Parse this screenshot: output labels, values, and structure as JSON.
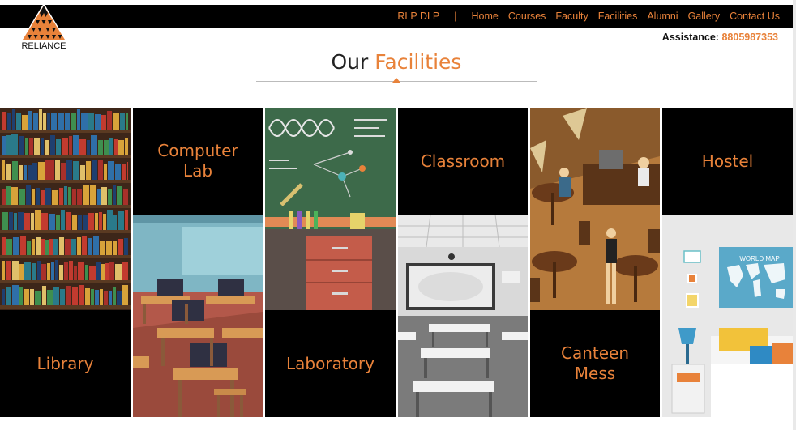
{
  "brand": {
    "name": "RELIANCE"
  },
  "nav": {
    "items": [
      "RLP DLP",
      "Home",
      "Courses",
      "Faculty",
      "Facilities",
      "Alumni",
      "Gallery",
      "Contact Us"
    ],
    "separator": "|"
  },
  "assistance": {
    "label": "Assistance:",
    "phone": "8805987353"
  },
  "heading": {
    "prefix": "Our",
    "accent": "Facilities"
  },
  "facilities": {
    "library": "Library",
    "computer_lab": "Computer\nLab",
    "laboratory": "Laboratory",
    "classroom": "Classroom",
    "canteen": "Canteen\nMess",
    "hostel": "Hostel"
  },
  "illustrations": {
    "world_map_text": "WORLD MAP"
  },
  "colors": {
    "accent": "#e8823a",
    "topbar": "#000000",
    "tile_bg": "#000000"
  }
}
